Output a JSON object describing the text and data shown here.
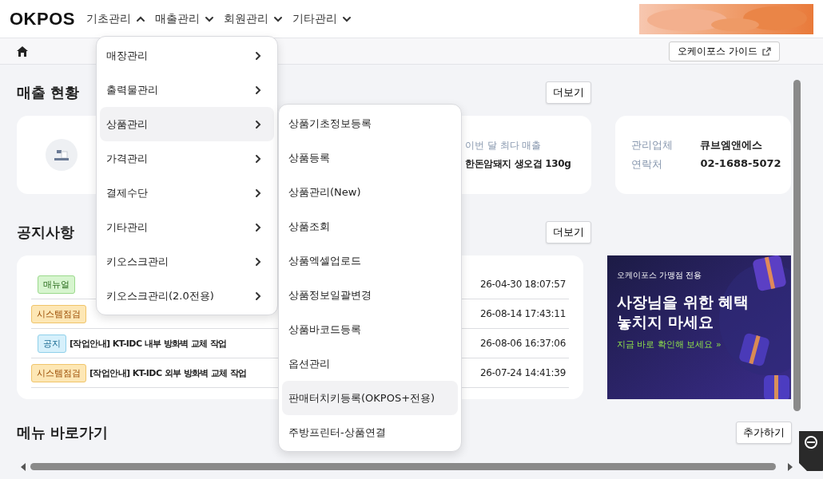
{
  "header": {
    "logo": "OKPOS",
    "nav": [
      {
        "label": "기초관리",
        "expanded": true
      },
      {
        "label": "매출관리",
        "expanded": false
      },
      {
        "label": "회원관리",
        "expanded": false
      },
      {
        "label": "기타관리",
        "expanded": false
      }
    ]
  },
  "breadcrumb": {
    "guide_button": "오케이포스 가이드"
  },
  "sales": {
    "title": "매출 현황",
    "more_button": "더보기",
    "top_item_label": "이번 달 최다 매출",
    "top_item_value": "한돈암돼지 생오겹 130g"
  },
  "manager": {
    "rows": [
      {
        "label": "관리업체",
        "value": "큐브엠앤에스"
      },
      {
        "label": "연락처",
        "value": "02-1688-5072"
      }
    ]
  },
  "notices": {
    "title": "공지사항",
    "more_button": "더보기",
    "rows": [
      {
        "tag": "매뉴얼",
        "kind": "manual",
        "date": "26-04-30 18:07:57"
      },
      {
        "tag": "시스템점검",
        "kind": "inspection",
        "date": "26-08-14 17:43:11"
      },
      {
        "tag": "공지",
        "kind": "notice",
        "title": "[작업안내] KT-IDC 내부 방화벽 교체 작업",
        "date": "26-08-06 16:37:06"
      },
      {
        "tag": "시스템점검",
        "kind": "inspection",
        "title": "[작업안내] KT-IDC 외부 방화벽 교체 작업",
        "date": "26-07-24 14:41:39"
      }
    ]
  },
  "banner": {
    "eyebrow": "오케이포스 가맹점 전용",
    "headline": [
      "사장님을 위한 혜택",
      "놓치지 마세요"
    ],
    "cta": "지금 바로 확인해 보세요 »"
  },
  "shortcuts": {
    "title": "메뉴 바로가기",
    "add_button": "추가하기"
  },
  "menu": {
    "items": [
      {
        "label": "매장관리",
        "selected": false
      },
      {
        "label": "출력물관리",
        "selected": false
      },
      {
        "label": "상품관리",
        "selected": true
      },
      {
        "label": "가격관리",
        "selected": false
      },
      {
        "label": "결제수단",
        "selected": false
      },
      {
        "label": "기타관리",
        "selected": false
      },
      {
        "label": "키오스크관리",
        "selected": false
      },
      {
        "label": "키오스크관리(2.0전용)",
        "selected": false
      }
    ]
  },
  "submenu": {
    "items": [
      {
        "label": "상품기초정보등록",
        "selected": false
      },
      {
        "label": "상품등록",
        "selected": false
      },
      {
        "label": "상품관리(New)",
        "selected": false
      },
      {
        "label": "상품조회",
        "selected": false
      },
      {
        "label": "상품엑셀업로드",
        "selected": false
      },
      {
        "label": "상품정보일괄변경",
        "selected": false
      },
      {
        "label": "상품바코드등록",
        "selected": false
      },
      {
        "label": "옵션관리",
        "selected": false
      },
      {
        "label": "판매터치키등록(OKPOS+전용)",
        "selected": true
      },
      {
        "label": "주방프린터-상품연결",
        "selected": false
      }
    ]
  }
}
